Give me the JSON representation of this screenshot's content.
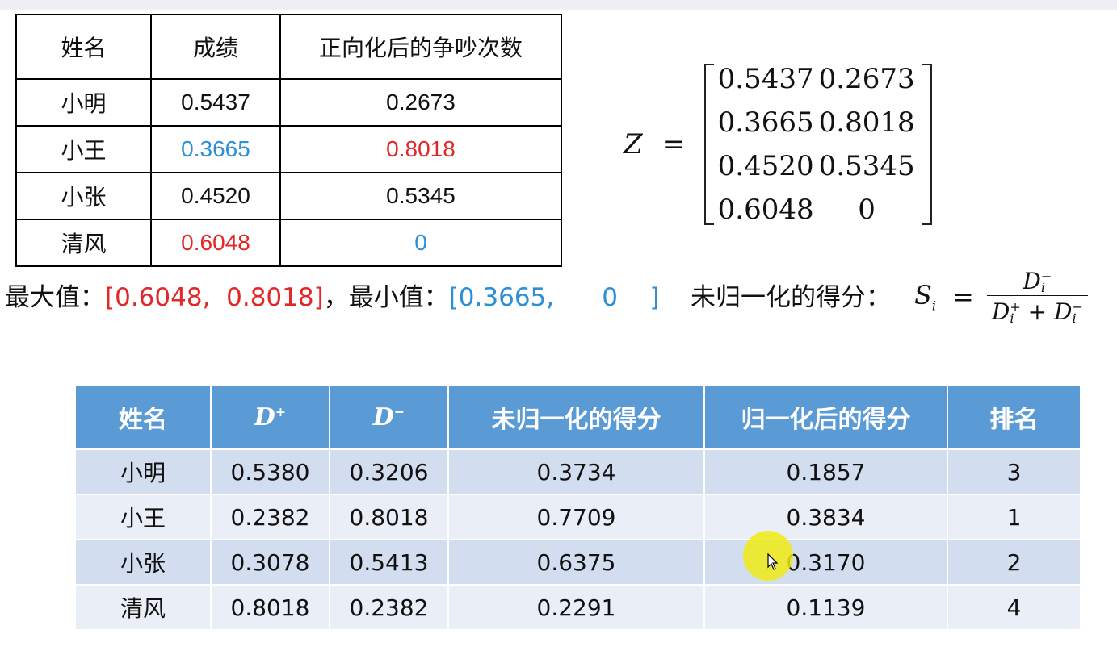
{
  "table1": {
    "headers": [
      "姓名",
      "成绩",
      "正向化后的争吵次数"
    ],
    "rows": [
      {
        "name": "小明",
        "score": "0.5437",
        "fights": "0.2673"
      },
      {
        "name": "小王",
        "score": "0.3665",
        "fights": "0.8018"
      },
      {
        "name": "小张",
        "score": "0.4520",
        "fights": "0.5345"
      },
      {
        "name": "清风",
        "score": "0.6048",
        "fights": "0"
      }
    ]
  },
  "matrix": {
    "label": "Z",
    "equals": "=",
    "cells": [
      "0.5437",
      "0.2673",
      "0.3665",
      "0.8018",
      "0.4520",
      "0.5345",
      "0.6048",
      "0"
    ]
  },
  "extremes": {
    "max_label": "最大值：",
    "max_value": "[0.6048,  0.8018]",
    "sep": "，",
    "min_label": "最小值：",
    "min_value": "[0.3665,      0    ]"
  },
  "score_formula": {
    "label": "未归一化的得分：",
    "lhs": "S",
    "lhs_sub": "i",
    "equals": "=",
    "num": "D",
    "den_plus": "D",
    "plus": " + ",
    "den_minus": "D",
    "sup_minus": "−",
    "sup_plus": "+",
    "sub_i": "i"
  },
  "table2": {
    "headers": {
      "name": "姓名",
      "dplus": "D",
      "dplus_sup": "+",
      "dminus": "D",
      "dminus_sup": "−",
      "raw": "未归一化的得分",
      "norm": "归一化后的得分",
      "rank": "排名"
    },
    "rows": [
      {
        "name": "小明",
        "dplus": "0.5380",
        "dminus": "0.3206",
        "raw": "0.3734",
        "norm": "0.1857",
        "rank": "3"
      },
      {
        "name": "小王",
        "dplus": "0.2382",
        "dminus": "0.8018",
        "raw": "0.7709",
        "norm": "0.3834",
        "rank": "1"
      },
      {
        "name": "小张",
        "dplus": "0.3078",
        "dminus": "0.5413",
        "raw": "0.6375",
        "norm": "0.3170",
        "rank": "2"
      },
      {
        "name": "清风",
        "dplus": "0.8018",
        "dminus": "0.2382",
        "raw": "0.2291",
        "norm": "0.1139",
        "rank": "4"
      }
    ]
  },
  "colors": {
    "highlight_max": "#e02828",
    "highlight_min": "#2d8fd6",
    "header_bg": "#5b9bd5",
    "row_odd": "#d2deef",
    "row_even": "#eaeff7"
  }
}
